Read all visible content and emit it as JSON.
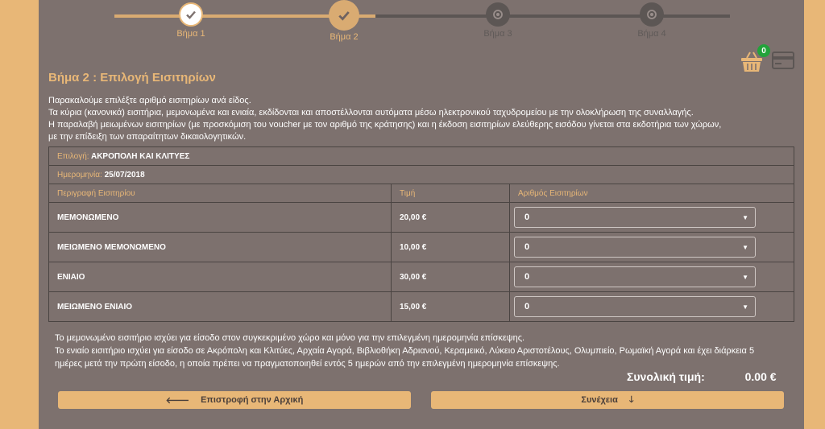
{
  "stepper": {
    "steps": [
      {
        "label": "Βήμα 1",
        "state": "done"
      },
      {
        "label": "Βήμα 2",
        "state": "current"
      },
      {
        "label": "Βήμα 3",
        "state": "pending"
      },
      {
        "label": "Βήμα 4",
        "state": "pending"
      }
    ]
  },
  "cart": {
    "count": "0",
    "icon": "basket-icon"
  },
  "page_title": "Βήμα 2 : Επιλογή Εισιτηρίων",
  "intro": [
    "Παρακαλούμε επιλέξτε αριθμό εισιτηρίων ανά είδος.",
    "Τα κύρια (κανονικά) εισιτήρια, μεμονωμένα και ενιαία, εκδίδονται και αποστέλλονται αυτόματα μέσω ηλεκτρονικού ταχυδρομείου με την ολοκλήρωση της συναλλαγής.",
    "Η παραλαβή μειωμένων εισιτηρίων (με προσκόμιση του voucher με τον αριθμό της κράτησης) και η έκδοση εισιτηρίων ελεύθερης εισόδου γίνεται στα εκδοτήρια των χώρων,",
    "με την επίδειξη των απαραίτητων δικαιολογητικών."
  ],
  "selection": {
    "label": "Επιλογή:",
    "value": "ΑΚΡΟΠΟΛΗ ΚΑΙ ΚΛΙΤΥΕΣ"
  },
  "date": {
    "label": "Ημερομηνία:",
    "value": "25/07/2018"
  },
  "table": {
    "headers": [
      "Περιγραφή Εισιτηρίου",
      "Τιμή",
      "Αριθμός Εισιτηρίων"
    ],
    "rows": [
      {
        "description": "ΜΕΜΟΝΩΜΕΝΟ",
        "price": "20,00 €",
        "quantity": "0"
      },
      {
        "description": "ΜΕΙΩΜΕΝΟ ΜΕΜΟΝΩΜΕΝΟ",
        "price": "10,00 €",
        "quantity": "0"
      },
      {
        "description": "ΕΝΙΑΙΟ",
        "price": "30,00 €",
        "quantity": "0"
      },
      {
        "description": "ΜΕΙΩΜΕΝΟ ΕΝΙΑΙΟ",
        "price": "15,00 €",
        "quantity": "0"
      }
    ]
  },
  "notes": [
    "Το μεμονωμένο εισιτήριο ισχύει για είσοδο στον συγκεκριμένο χώρο και μόνο για την επιλεγμένη ημερομηνία επίσκεψης.",
    "Το ενιαίο εισιτήριο ισχύει για είσοδο σε Ακρόπολη και Κλιτύες, Αρχαία Αγορά, Βιβλιοθήκη Αδριανού, Κεραμεικό, Λύκειο Αριστοτέλους, Ολυμπιείο, Ρωμαϊκή Αγορά και έχει διάρκεια 5",
    "ημέρες μετά την πρώτη είσοδο, η οποία πρέπει να πραγματοποιηθεί εντός 5 ημερών από την επιλεγμένη ημερομηνία επίσκεψης."
  ],
  "total": {
    "label": "Συνολική τιμή:",
    "amount": "0.00 €"
  },
  "buttons": {
    "back": "Επιστροφή στην Αρχική",
    "next": "Συνέχεια"
  },
  "colors": {
    "accent": "#e8b777",
    "panel": "#7d716e",
    "badge": "#22a33a"
  }
}
